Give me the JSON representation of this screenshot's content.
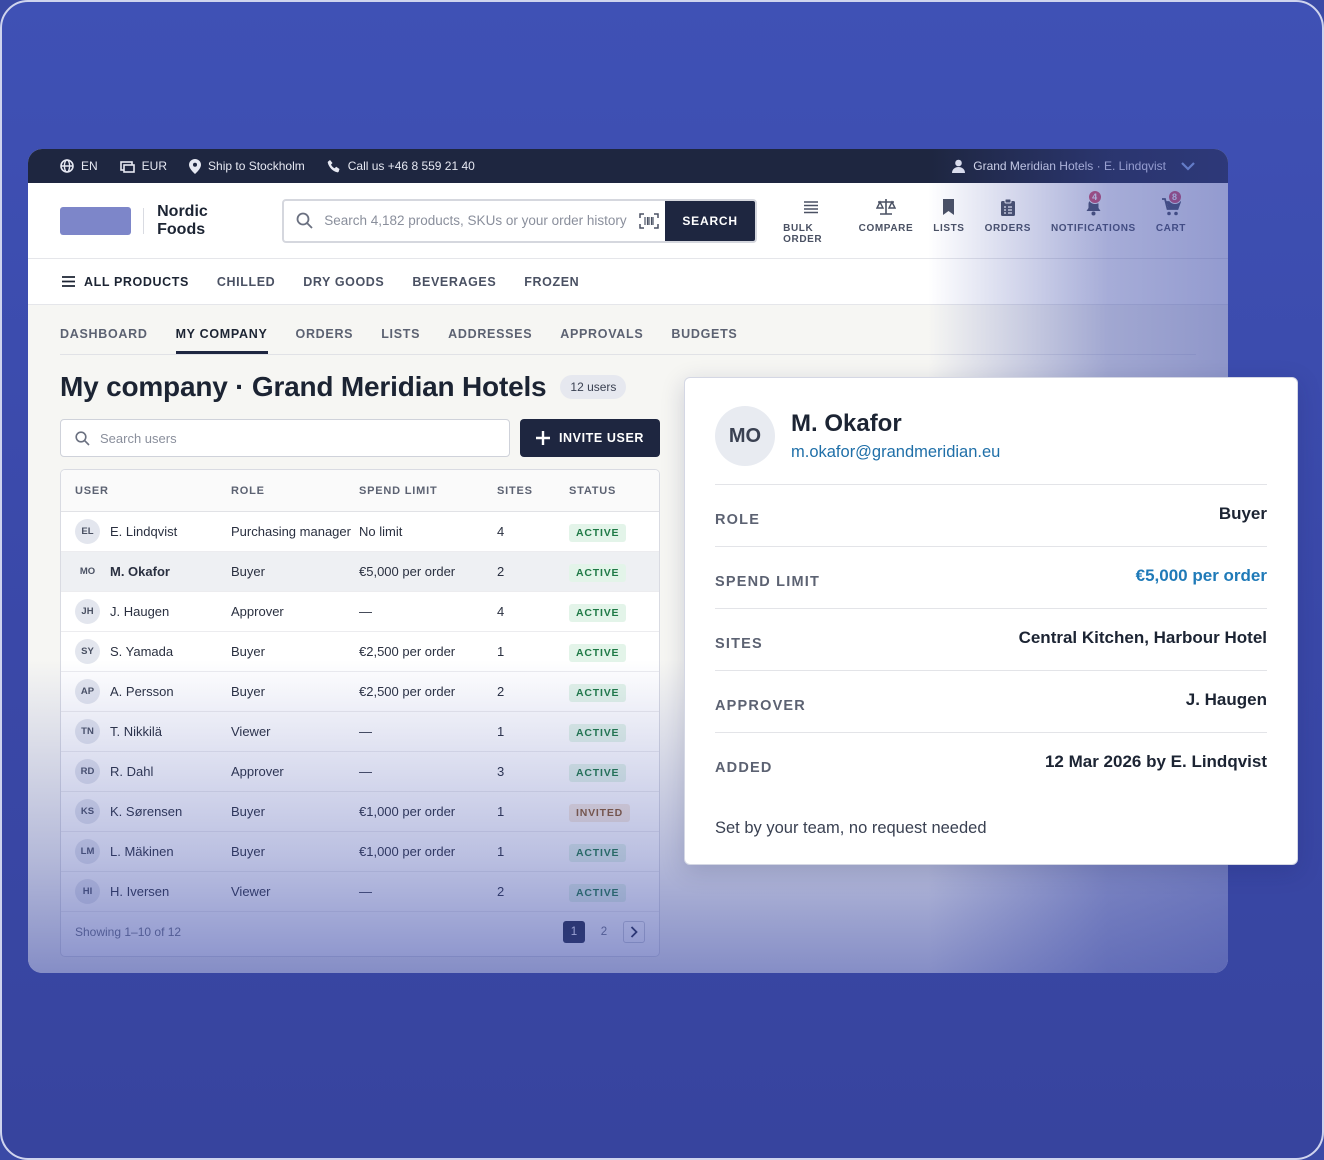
{
  "topbar": {
    "language": "EN",
    "currency": "EUR",
    "ship_to": "Ship to Stockholm",
    "call": "Call us +46 8 559 21 40",
    "account": "Grand Meridian Hotels · E. Lindqvist"
  },
  "header": {
    "brand": "Nordic Foods",
    "search_placeholder": "Search 4,182 products, SKUs or your order history",
    "search_button": "SEARCH",
    "nav": [
      {
        "label": "BULK ORDER",
        "icon": "list-icon"
      },
      {
        "label": "COMPARE",
        "icon": "scale-icon"
      },
      {
        "label": "LISTS",
        "icon": "bookmark-icon"
      },
      {
        "label": "ORDERS",
        "icon": "clipboard-icon"
      },
      {
        "label": "NOTIFICATIONS",
        "icon": "bell-icon",
        "badge": "4"
      },
      {
        "label": "CART",
        "icon": "cart-icon",
        "badge": "8"
      }
    ]
  },
  "categories": [
    "ALL PRODUCTS",
    "CHILLED",
    "DRY GOODS",
    "BEVERAGES",
    "FROZEN"
  ],
  "subnav": [
    "DASHBOARD",
    "MY COMPANY",
    "ORDERS",
    "LISTS",
    "ADDRESSES",
    "APPROVALS",
    "BUDGETS"
  ],
  "page": {
    "title": "My company · Grand Meridian Hotels",
    "user_count": "12 users",
    "search_users_placeholder": "Search users",
    "invite_button": "INVITE USER"
  },
  "table": {
    "columns": [
      "USER",
      "ROLE",
      "SPEND LIMIT",
      "SITES",
      "STATUS"
    ],
    "rows": [
      {
        "initials": "EL",
        "name": "E. Lindqvist",
        "role": "Purchasing manager",
        "limit": "No limit",
        "sites": "4",
        "status": "ACTIVE"
      },
      {
        "initials": "MO",
        "name": "M. Okafor",
        "role": "Buyer",
        "limit": "€5,000 per order",
        "sites": "2",
        "status": "ACTIVE"
      },
      {
        "initials": "JH",
        "name": "J. Haugen",
        "role": "Approver",
        "limit": "—",
        "sites": "4",
        "status": "ACTIVE"
      },
      {
        "initials": "SY",
        "name": "S. Yamada",
        "role": "Buyer",
        "limit": "€2,500 per order",
        "sites": "1",
        "status": "ACTIVE"
      },
      {
        "initials": "AP",
        "name": "A. Persson",
        "role": "Buyer",
        "limit": "€2,500 per order",
        "sites": "2",
        "status": "ACTIVE"
      },
      {
        "initials": "TN",
        "name": "T. Nikkilä",
        "role": "Viewer",
        "limit": "—",
        "sites": "1",
        "status": "ACTIVE"
      },
      {
        "initials": "RD",
        "name": "R. Dahl",
        "role": "Approver",
        "limit": "—",
        "sites": "3",
        "status": "ACTIVE"
      },
      {
        "initials": "KS",
        "name": "K. Sørensen",
        "role": "Buyer",
        "limit": "€1,000 per order",
        "sites": "1",
        "status": "INVITED"
      },
      {
        "initials": "LM",
        "name": "L. Mäkinen",
        "role": "Buyer",
        "limit": "€1,000 per order",
        "sites": "1",
        "status": "ACTIVE"
      },
      {
        "initials": "HI",
        "name": "H. Iversen",
        "role": "Viewer",
        "limit": "—",
        "sites": "2",
        "status": "ACTIVE"
      }
    ],
    "footer": "Showing 1–10 of 12",
    "pages": [
      "1",
      "2"
    ]
  },
  "detail": {
    "initials": "MO",
    "name": "M. Okafor",
    "email": "m.okafor@grandmeridian.eu",
    "fields": [
      {
        "label": "ROLE",
        "value": "Buyer"
      },
      {
        "label": "SPEND LIMIT",
        "value": "€5,000 per order"
      },
      {
        "label": "SITES",
        "value": "Central Kitchen, Harbour Hotel"
      },
      {
        "label": "APPROVER",
        "value": "J. Haugen"
      },
      {
        "label": "ADDED",
        "value": "12 Mar 2026 by E. Lindqvist"
      }
    ],
    "note": "Set by your team, no request needed"
  },
  "colors": {
    "navy": "#1e2640",
    "background": "#3f51b5",
    "active_green": "#1f7a46",
    "link_blue": "#1f7ab8",
    "badge": "#d9506b"
  }
}
